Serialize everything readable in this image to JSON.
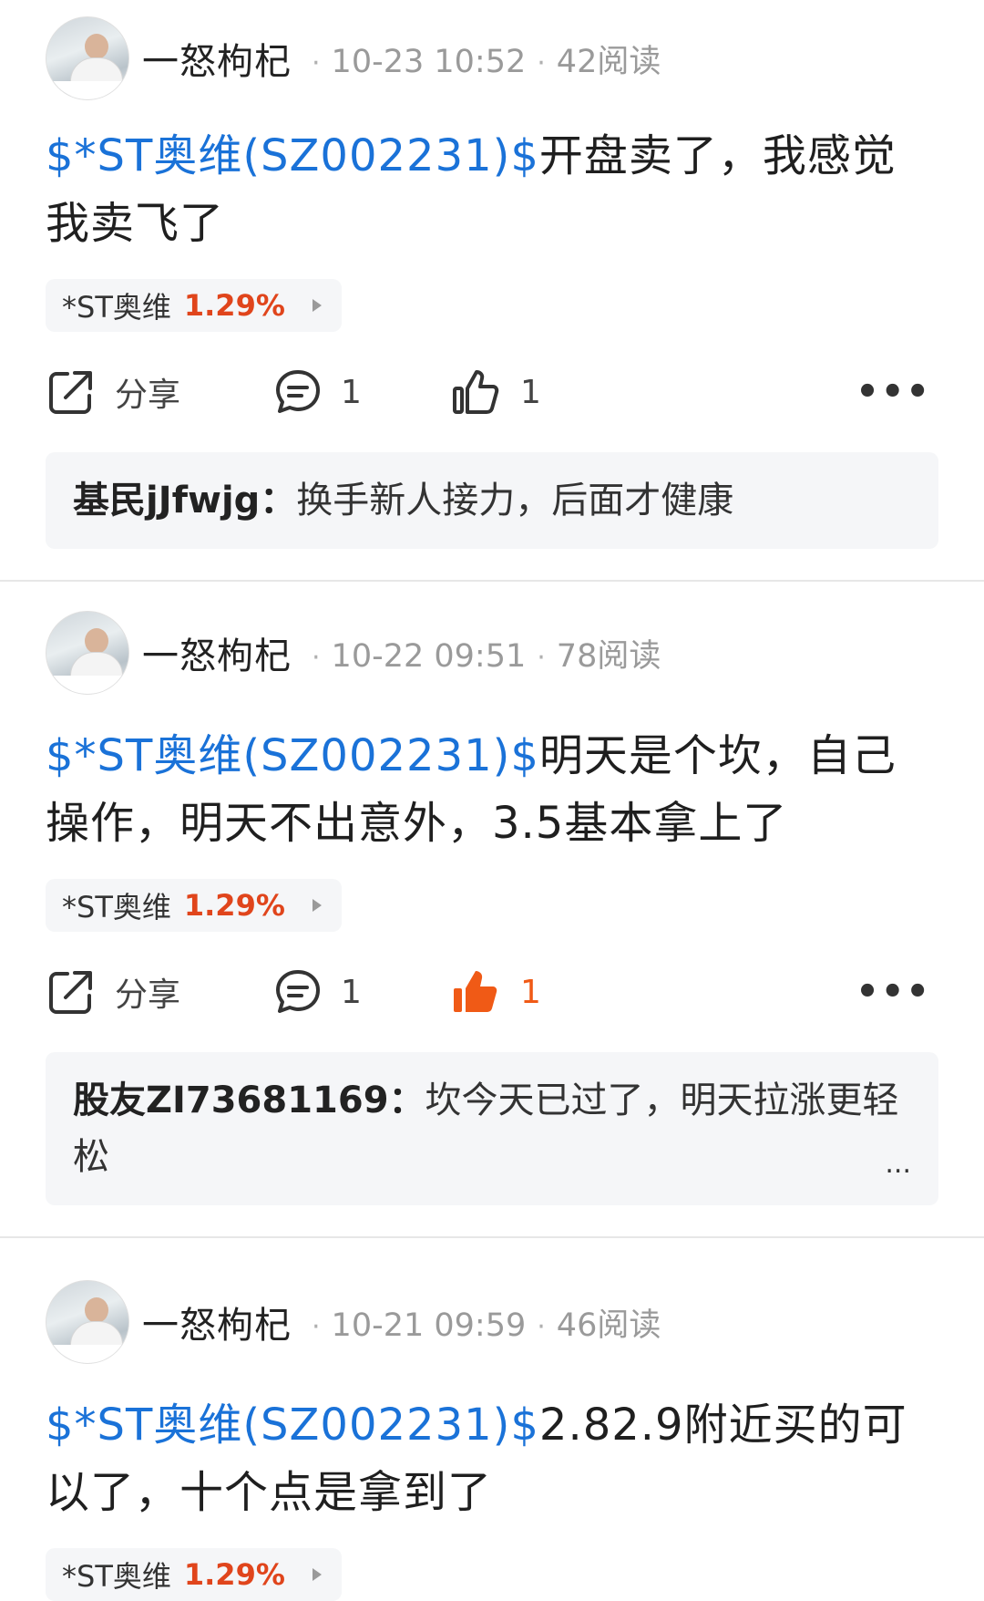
{
  "posts": [
    {
      "author": "一怒枸杞",
      "time": "10-23 10:52",
      "reads": "42阅读",
      "tag": "$*ST奥维(SZ002231)$",
      "text": "开盘卖了，我感觉我卖飞了",
      "stock": {
        "name": "*ST奥维",
        "change": "1.29%"
      },
      "share_label": "分享",
      "comments": "1",
      "likes": "1",
      "liked": false,
      "comment": {
        "user": "基民jJfwjg：",
        "text": "换手新人接力，后面才健康",
        "truncated": false
      }
    },
    {
      "author": "一怒枸杞",
      "time": "10-22 09:51",
      "reads": "78阅读",
      "tag": "$*ST奥维(SZ002231)$",
      "text": "明天是个坎，自己操作，明天不出意外，3.5基本拿上了",
      "stock": {
        "name": "*ST奥维",
        "change": "1.29%"
      },
      "share_label": "分享",
      "comments": "1",
      "likes": "1",
      "liked": true,
      "comment": {
        "user": "股友ZI73681169：",
        "text": "坎今天已过了，明天拉涨更轻松",
        "truncated": true,
        "ellipsis": "..."
      }
    },
    {
      "author": "一怒枸杞",
      "time": "10-21 09:59",
      "reads": "46阅读",
      "tag": "$*ST奥维(SZ002231)$",
      "text": "2.82.9附近买的可以了，十个点是拿到了",
      "stock": {
        "name": "*ST奥维",
        "change": "1.29%"
      }
    }
  ],
  "colors": {
    "link": "#1a72d8",
    "up": "#e0451c",
    "liked": "#f05a16",
    "meta": "#9a9a9a"
  },
  "icons": [
    "share-icon",
    "comment-icon",
    "thumbs-up-icon",
    "more-icon"
  ]
}
